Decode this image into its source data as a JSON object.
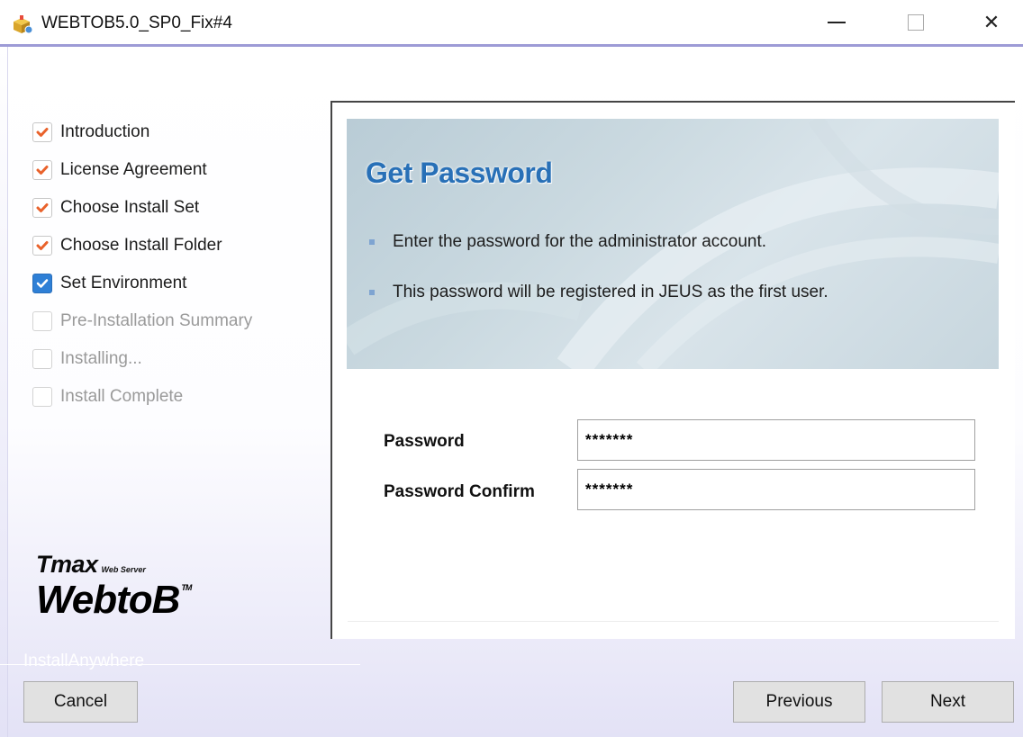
{
  "window": {
    "title": "WEBTOB5.0_SP0_Fix#4",
    "minimize_glyph": "",
    "close_glyph": "✕",
    "icon": "installer-icon"
  },
  "sidebar": {
    "steps": [
      {
        "label": "Introduction",
        "state": "done"
      },
      {
        "label": "License Agreement",
        "state": "done"
      },
      {
        "label": "Choose Install Set",
        "state": "done"
      },
      {
        "label": "Choose Install Folder",
        "state": "done"
      },
      {
        "label": "Set Environment",
        "state": "current"
      },
      {
        "label": "Pre-Installation Summary",
        "state": "pending"
      },
      {
        "label": "Installing...",
        "state": "pending"
      },
      {
        "label": "Install Complete",
        "state": "pending"
      }
    ],
    "logo": {
      "brand": "Tmax",
      "subtitle": "Web Server",
      "product": "WebtoB",
      "trademark": "TM"
    },
    "installer_credit": "InstallAnywhere"
  },
  "banner": {
    "title": "Get Password",
    "bullets": [
      "Enter the password for the administrator account.",
      "This password will be registered in JEUS as the first user."
    ]
  },
  "form": {
    "password_label": "Password",
    "password_value": "*******",
    "confirm_label": "Password Confirm",
    "confirm_value": "*******"
  },
  "buttons": {
    "cancel": "Cancel",
    "previous": "Previous",
    "next": "Next"
  },
  "colors": {
    "accent": "#2870b7",
    "check_done": "#e9622b",
    "check_current_bg": "#2e7fd6",
    "title_border": "#9d9bd6"
  }
}
